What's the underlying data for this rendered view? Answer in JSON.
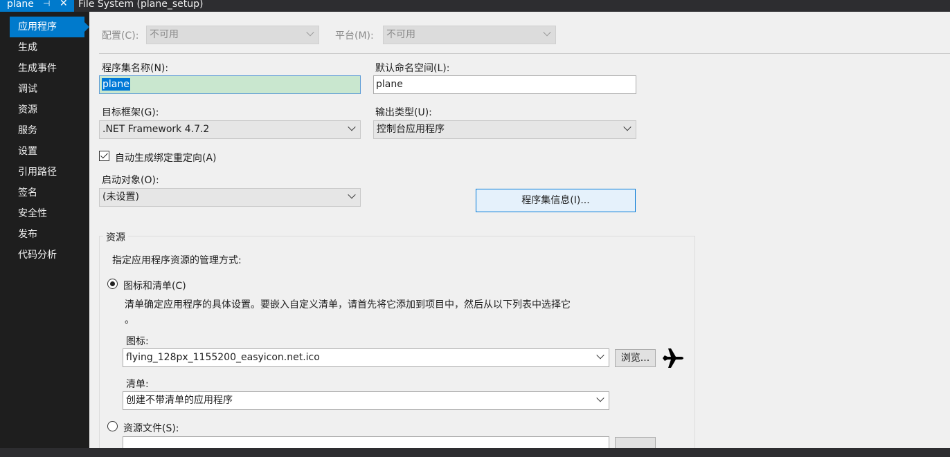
{
  "tabs": {
    "active": "plane",
    "pin_glyph": "⊣",
    "close_glyph": "✕",
    "inactive": "File System (plane_setup)"
  },
  "nav": {
    "items": [
      "应用程序",
      "生成",
      "生成事件",
      "调试",
      "资源",
      "服务",
      "设置",
      "引用路径",
      "签名",
      "安全性",
      "发布",
      "代码分析"
    ],
    "active_index": 0
  },
  "config": {
    "config_label": "配置(C):",
    "config_value": "不可用",
    "platform_label": "平台(M):",
    "platform_value": "不可用"
  },
  "form": {
    "assembly_name_label": "程序集名称(N):",
    "assembly_name_value": "plane",
    "default_ns_label": "默认命名空间(L):",
    "default_ns_value": "plane",
    "target_fw_label": "目标框架(G):",
    "target_fw_value": ".NET Framework 4.7.2",
    "output_type_label": "输出类型(U):",
    "output_type_value": "控制台应用程序",
    "auto_binding_label": "自动生成绑定重定向(A)",
    "startup_label": "启动对象(O):",
    "startup_value": "(未设置)",
    "assembly_info_button": "程序集信息(I)..."
  },
  "resources": {
    "group_title": "资源",
    "description": "指定应用程序资源的管理方式:",
    "icon_manifest_label": "图标和清单(C)",
    "icon_manifest_desc_line1": "清单确定应用程序的具体设置。要嵌入自定义清单，请首先将它添加到项目中，然后从以下列表中选择它",
    "icon_manifest_desc_line2": "。",
    "icon_label": "图标:",
    "icon_value": "flying_128px_1155200_easyicon.net.ico",
    "browse_button": "浏览...",
    "manifest_label": "清单:",
    "manifest_value": "创建不带清单的应用程序",
    "resource_file_label": "资源文件(S):"
  },
  "colors": {
    "accent": "#007acc",
    "nav_bg": "#1e1e1e",
    "content_bg": "#f0f0f0"
  }
}
